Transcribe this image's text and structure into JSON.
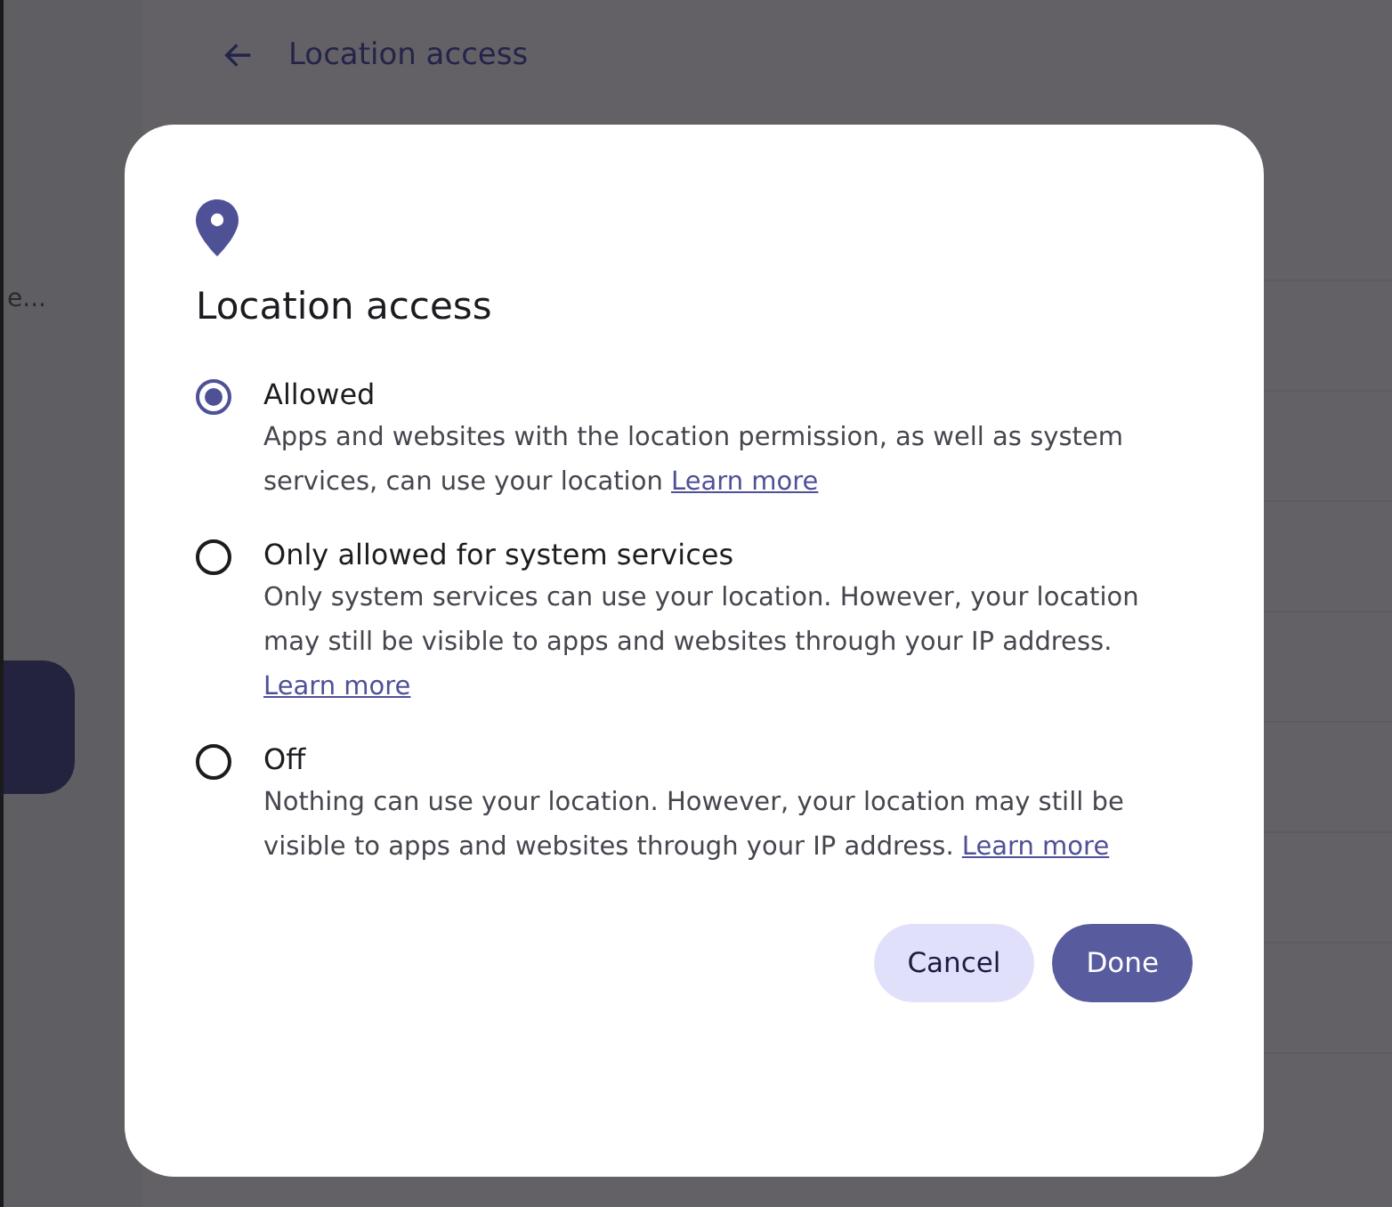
{
  "background": {
    "sidebar_text": "e...",
    "header": {
      "title": "Location access"
    }
  },
  "dialog": {
    "title": "Location access",
    "options": [
      {
        "label": "Allowed",
        "description": "Apps and websites with the location permission, as well as system services, can use your location",
        "link": "Learn more",
        "selected": true
      },
      {
        "label": "Only allowed for system services",
        "description": "Only system services can use your location. However, your location may still be visible to apps and websites through your IP address.",
        "link": "Learn more",
        "selected": false
      },
      {
        "label": "Off",
        "description": "Nothing can use your location. However, your location may still be visible to apps and websites through your IP address.",
        "link": "Learn more",
        "selected": false
      }
    ],
    "buttons": [
      {
        "label": "Cancel",
        "kind": "secondary"
      },
      {
        "label": "Done",
        "kind": "primary"
      }
    ]
  }
}
